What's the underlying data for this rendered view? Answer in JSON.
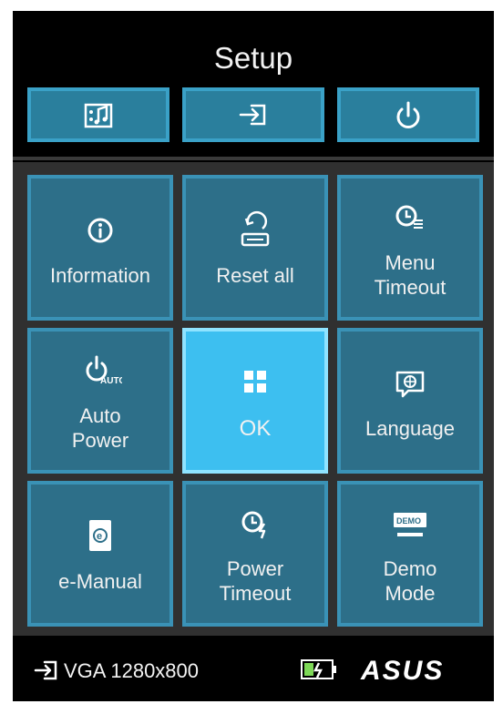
{
  "header": {
    "title": "Setup"
  },
  "tabs": [
    {
      "icon": "picture-settings-icon"
    },
    {
      "icon": "input-source-icon"
    },
    {
      "icon": "power-icon"
    }
  ],
  "tiles": [
    {
      "label": "Information",
      "icon": "info-icon"
    },
    {
      "label": "Reset all",
      "icon": "reset-icon"
    },
    {
      "label": "Menu\nTimeout",
      "icon": "menu-timeout-icon"
    },
    {
      "label": "Auto\nPower",
      "icon": "auto-power-icon"
    },
    {
      "label": "OK",
      "icon": "grid-icon",
      "selected": true
    },
    {
      "label": "Language",
      "icon": "language-icon"
    },
    {
      "label": "e-Manual",
      "icon": "e-manual-icon"
    },
    {
      "label": "Power\nTimeout",
      "icon": "power-timeout-icon"
    },
    {
      "label": "Demo\nMode",
      "icon": "demo-mode-icon"
    }
  ],
  "demo_badge": "DEMO",
  "status": {
    "input": "VGA 1280x800",
    "input_icon": "input-source-icon",
    "battery_icon": "battery-charging-icon",
    "brand": "ASUS"
  },
  "colors": {
    "tile": "#2d6f89",
    "tile_border": "#3a92b6",
    "selected_tile": "#3dbff0",
    "background": "#000000"
  }
}
